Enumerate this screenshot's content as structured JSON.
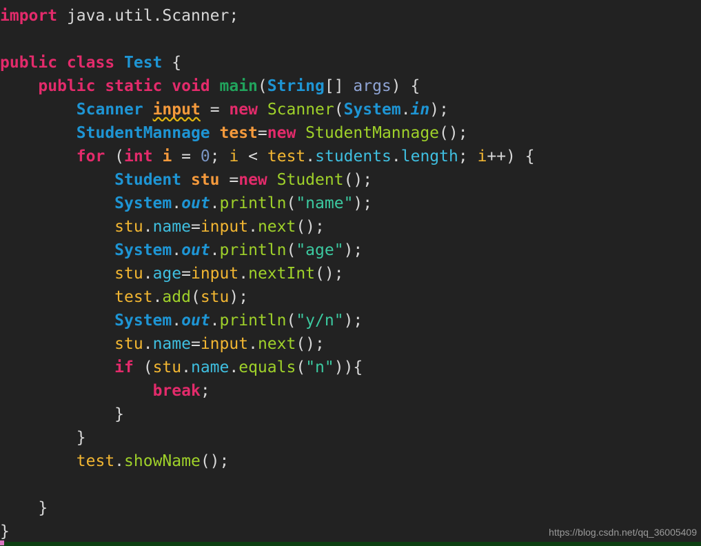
{
  "editor": {
    "background": "#222222",
    "theme_name": "dark-monokai-like",
    "language": "java",
    "font_size_px": 23,
    "line_height_px": 34
  },
  "watermark": {
    "text": "https://blog.csdn.net/qq_36005409",
    "color": "#9a9a9a"
  },
  "status_bar": {
    "color": "#0d3f12",
    "marker_color": "#d976c0"
  },
  "colors": {
    "keyword": "#e32b6b",
    "type": "#1e95d4",
    "method": "#21a35c",
    "call": "#9fd12a",
    "field": "#3fbfe0",
    "variable_decl": "#f59a3c",
    "variable_use": "#f2b632",
    "string": "#3cc9a0",
    "number": "#7a95c4",
    "plain": "#d8d8d8",
    "warning_squiggle": "#e0b410"
  },
  "code": {
    "full_text": "import java.util.Scanner;\n\npublic class Test {\n    public static void main(String[] args) {\n        Scanner input = new Scanner(System.in);\n        StudentMannage test=new StudentMannage();\n        for (int i = 0; i < test.students.length; i++) {\n            Student stu =new Student();\n            System.out.println(\"name\");\n            stu.name=input.next();\n            System.out.println(\"age\");\n            stu.age=input.nextInt();\n            test.add(stu);\n            System.out.println(\"y/n\");\n            stu.name=input.next();\n            if (stu.name.equals(\"n\")){\n                break;\n            }\n        }\n        test.showName();\n\n    }\n}",
    "lines": [
      {
        "n": 1,
        "text": "import java.util.Scanner;",
        "tokens": [
          {
            "t": "import",
            "c": "kw"
          },
          {
            "t": " ",
            "c": "plain"
          },
          {
            "t": "java.util.Scanner;",
            "c": "plain"
          }
        ]
      },
      {
        "n": 2,
        "text": "",
        "tokens": []
      },
      {
        "n": 3,
        "text": "public class Test {",
        "tokens": [
          {
            "t": "public class ",
            "c": "kw"
          },
          {
            "t": "Test",
            "c": "type"
          },
          {
            "t": " {",
            "c": "plain"
          }
        ]
      },
      {
        "n": 4,
        "text": "    public static void main(String[] args) {",
        "tokens": [
          {
            "t": "    ",
            "c": "plain"
          },
          {
            "t": "public static void ",
            "c": "kw"
          },
          {
            "t": "main",
            "c": "method"
          },
          {
            "t": "(",
            "c": "plain"
          },
          {
            "t": "String",
            "c": "type"
          },
          {
            "t": "[] ",
            "c": "plain"
          },
          {
            "t": "args",
            "c": "args"
          },
          {
            "t": ") {",
            "c": "plain"
          }
        ]
      },
      {
        "n": 5,
        "text": "        Scanner input = new Scanner(System.in);",
        "tokens": [
          {
            "t": "        ",
            "c": "plain"
          },
          {
            "t": "Scanner",
            "c": "type"
          },
          {
            "t": " ",
            "c": "plain"
          },
          {
            "t": "input",
            "c": "var squiggle"
          },
          {
            "t": " ",
            "c": "plain"
          },
          {
            "t": "=",
            "c": "op"
          },
          {
            "t": " ",
            "c": "plain"
          },
          {
            "t": "new",
            "c": "kw"
          },
          {
            "t": " ",
            "c": "plain"
          },
          {
            "t": "Scanner",
            "c": "ctor"
          },
          {
            "t": "(",
            "c": "plain"
          },
          {
            "t": "System",
            "c": "type"
          },
          {
            "t": ".",
            "c": "plain"
          },
          {
            "t": "in",
            "c": "fieldital"
          },
          {
            "t": ");",
            "c": "plain"
          }
        ]
      },
      {
        "n": 6,
        "text": "        StudentMannage test=new StudentMannage();",
        "tokens": [
          {
            "t": "        ",
            "c": "plain"
          },
          {
            "t": "StudentMannage",
            "c": "type"
          },
          {
            "t": " ",
            "c": "plain"
          },
          {
            "t": "test",
            "c": "var"
          },
          {
            "t": "=",
            "c": "op"
          },
          {
            "t": "new",
            "c": "kw"
          },
          {
            "t": " ",
            "c": "plain"
          },
          {
            "t": "StudentMannage",
            "c": "ctor"
          },
          {
            "t": "();",
            "c": "plain"
          }
        ]
      },
      {
        "n": 7,
        "text": "        for (int i = 0; i < test.students.length; i++) {",
        "tokens": [
          {
            "t": "        ",
            "c": "plain"
          },
          {
            "t": "for",
            "c": "kw"
          },
          {
            "t": " (",
            "c": "plain"
          },
          {
            "t": "int",
            "c": "kw"
          },
          {
            "t": " ",
            "c": "plain"
          },
          {
            "t": "i",
            "c": "var"
          },
          {
            "t": " ",
            "c": "plain"
          },
          {
            "t": "=",
            "c": "op"
          },
          {
            "t": " ",
            "c": "plain"
          },
          {
            "t": "0",
            "c": "num"
          },
          {
            "t": "; ",
            "c": "plain"
          },
          {
            "t": "i",
            "c": "varuse"
          },
          {
            "t": " ",
            "c": "plain"
          },
          {
            "t": "<",
            "c": "op"
          },
          {
            "t": " ",
            "c": "plain"
          },
          {
            "t": "test",
            "c": "varuse"
          },
          {
            "t": ".",
            "c": "plain"
          },
          {
            "t": "students",
            "c": "field"
          },
          {
            "t": ".",
            "c": "plain"
          },
          {
            "t": "length",
            "c": "field"
          },
          {
            "t": "; ",
            "c": "plain"
          },
          {
            "t": "i",
            "c": "varuse"
          },
          {
            "t": "++) {",
            "c": "plain"
          }
        ]
      },
      {
        "n": 8,
        "text": "            Student stu =new Student();",
        "tokens": [
          {
            "t": "            ",
            "c": "plain"
          },
          {
            "t": "Student",
            "c": "type"
          },
          {
            "t": " ",
            "c": "plain"
          },
          {
            "t": "stu",
            "c": "var"
          },
          {
            "t": " ",
            "c": "plain"
          },
          {
            "t": "=",
            "c": "op"
          },
          {
            "t": "new",
            "c": "kw"
          },
          {
            "t": " ",
            "c": "plain"
          },
          {
            "t": "Student",
            "c": "ctor"
          },
          {
            "t": "();",
            "c": "plain"
          }
        ]
      },
      {
        "n": 9,
        "text": "            System.out.println(\"name\");",
        "tokens": [
          {
            "t": "            ",
            "c": "plain"
          },
          {
            "t": "System",
            "c": "type"
          },
          {
            "t": ".",
            "c": "plain"
          },
          {
            "t": "out",
            "c": "fieldital"
          },
          {
            "t": ".",
            "c": "plain"
          },
          {
            "t": "println",
            "c": "call"
          },
          {
            "t": "(",
            "c": "plain"
          },
          {
            "t": "\"name\"",
            "c": "str"
          },
          {
            "t": ");",
            "c": "plain"
          }
        ]
      },
      {
        "n": 10,
        "text": "            stu.name=input.next();",
        "tokens": [
          {
            "t": "            ",
            "c": "plain"
          },
          {
            "t": "stu",
            "c": "varuse"
          },
          {
            "t": ".",
            "c": "plain"
          },
          {
            "t": "name",
            "c": "field"
          },
          {
            "t": "=",
            "c": "op"
          },
          {
            "t": "input",
            "c": "varuse"
          },
          {
            "t": ".",
            "c": "plain"
          },
          {
            "t": "next",
            "c": "call"
          },
          {
            "t": "();",
            "c": "plain"
          }
        ]
      },
      {
        "n": 11,
        "text": "            System.out.println(\"age\");",
        "tokens": [
          {
            "t": "            ",
            "c": "plain"
          },
          {
            "t": "System",
            "c": "type"
          },
          {
            "t": ".",
            "c": "plain"
          },
          {
            "t": "out",
            "c": "fieldital"
          },
          {
            "t": ".",
            "c": "plain"
          },
          {
            "t": "println",
            "c": "call"
          },
          {
            "t": "(",
            "c": "plain"
          },
          {
            "t": "\"age\"",
            "c": "str"
          },
          {
            "t": ");",
            "c": "plain"
          }
        ]
      },
      {
        "n": 12,
        "text": "            stu.age=input.nextInt();",
        "tokens": [
          {
            "t": "            ",
            "c": "plain"
          },
          {
            "t": "stu",
            "c": "varuse"
          },
          {
            "t": ".",
            "c": "plain"
          },
          {
            "t": "age",
            "c": "field"
          },
          {
            "t": "=",
            "c": "op"
          },
          {
            "t": "input",
            "c": "varuse"
          },
          {
            "t": ".",
            "c": "plain"
          },
          {
            "t": "nextInt",
            "c": "call"
          },
          {
            "t": "();",
            "c": "plain"
          }
        ]
      },
      {
        "n": 13,
        "text": "            test.add(stu);",
        "tokens": [
          {
            "t": "            ",
            "c": "plain"
          },
          {
            "t": "test",
            "c": "varuse"
          },
          {
            "t": ".",
            "c": "plain"
          },
          {
            "t": "add",
            "c": "call"
          },
          {
            "t": "(",
            "c": "plain"
          },
          {
            "t": "stu",
            "c": "varuse"
          },
          {
            "t": ");",
            "c": "plain"
          }
        ]
      },
      {
        "n": 14,
        "text": "            System.out.println(\"y/n\");",
        "tokens": [
          {
            "t": "            ",
            "c": "plain"
          },
          {
            "t": "System",
            "c": "type"
          },
          {
            "t": ".",
            "c": "plain"
          },
          {
            "t": "out",
            "c": "fieldital"
          },
          {
            "t": ".",
            "c": "plain"
          },
          {
            "t": "println",
            "c": "call"
          },
          {
            "t": "(",
            "c": "plain"
          },
          {
            "t": "\"y/n\"",
            "c": "str"
          },
          {
            "t": ");",
            "c": "plain"
          }
        ]
      },
      {
        "n": 15,
        "text": "            stu.name=input.next();",
        "tokens": [
          {
            "t": "            ",
            "c": "plain"
          },
          {
            "t": "stu",
            "c": "varuse"
          },
          {
            "t": ".",
            "c": "plain"
          },
          {
            "t": "name",
            "c": "field"
          },
          {
            "t": "=",
            "c": "op"
          },
          {
            "t": "input",
            "c": "varuse"
          },
          {
            "t": ".",
            "c": "plain"
          },
          {
            "t": "next",
            "c": "call"
          },
          {
            "t": "();",
            "c": "plain"
          }
        ]
      },
      {
        "n": 16,
        "text": "            if (stu.name.equals(\"n\")){",
        "tokens": [
          {
            "t": "            ",
            "c": "plain"
          },
          {
            "t": "if",
            "c": "kw"
          },
          {
            "t": " (",
            "c": "plain"
          },
          {
            "t": "stu",
            "c": "varuse"
          },
          {
            "t": ".",
            "c": "plain"
          },
          {
            "t": "name",
            "c": "field"
          },
          {
            "t": ".",
            "c": "plain"
          },
          {
            "t": "equals",
            "c": "call"
          },
          {
            "t": "(",
            "c": "plain"
          },
          {
            "t": "\"n\"",
            "c": "str"
          },
          {
            "t": ")){",
            "c": "plain"
          }
        ]
      },
      {
        "n": 17,
        "text": "                break;",
        "tokens": [
          {
            "t": "                ",
            "c": "plain"
          },
          {
            "t": "break",
            "c": "kw"
          },
          {
            "t": ";",
            "c": "plain"
          }
        ]
      },
      {
        "n": 18,
        "text": "            }",
        "tokens": [
          {
            "t": "            }",
            "c": "plain"
          }
        ]
      },
      {
        "n": 19,
        "text": "        }",
        "tokens": [
          {
            "t": "        }",
            "c": "plain"
          }
        ]
      },
      {
        "n": 20,
        "text": "        test.showName();",
        "tokens": [
          {
            "t": "        ",
            "c": "plain"
          },
          {
            "t": "test",
            "c": "varuse"
          },
          {
            "t": ".",
            "c": "plain"
          },
          {
            "t": "showName",
            "c": "call"
          },
          {
            "t": "();",
            "c": "plain"
          }
        ]
      },
      {
        "n": 21,
        "text": "",
        "tokens": []
      },
      {
        "n": 22,
        "text": "    }",
        "tokens": [
          {
            "t": "    }",
            "c": "plain"
          }
        ]
      },
      {
        "n": 23,
        "text": "}",
        "tokens": [
          {
            "t": "}",
            "c": "plain"
          }
        ]
      }
    ]
  }
}
